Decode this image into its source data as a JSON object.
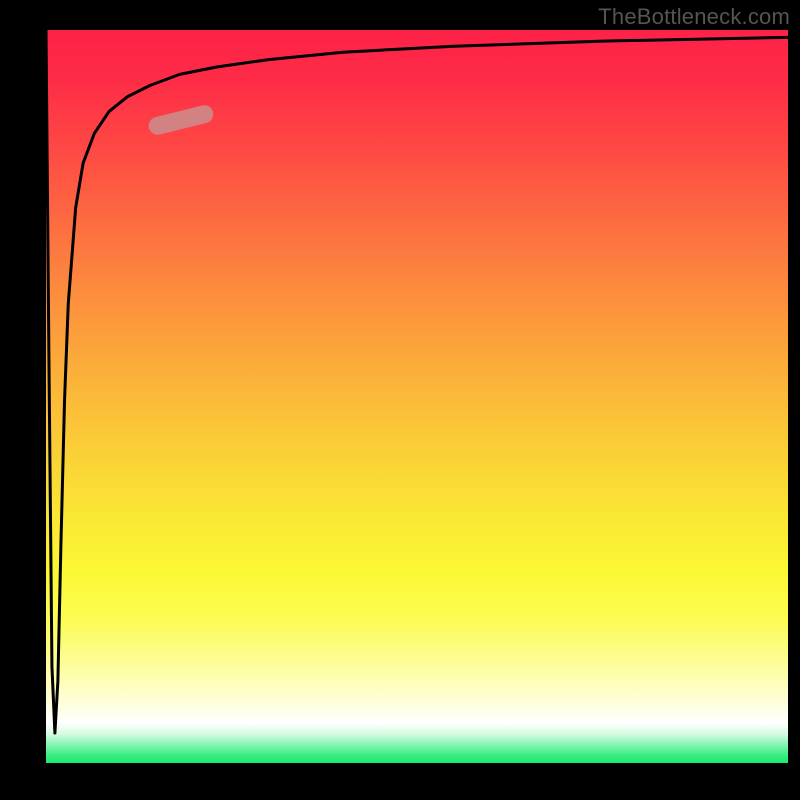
{
  "attribution": "TheBottleneck.com",
  "chart_data": {
    "type": "line",
    "title": "",
    "xlabel": "",
    "ylabel": "",
    "xlim": [
      0,
      100
    ],
    "ylim": [
      0,
      100
    ],
    "series": [
      {
        "name": "bottleneck-curve",
        "x": [
          0,
          0.4,
          0.8,
          1.2,
          1.6,
          2.0,
          2.5,
          3.0,
          4.0,
          5.0,
          6.5,
          8.5,
          11.0,
          14.0,
          18.0,
          23.0,
          30.0,
          40.0,
          55.0,
          75.0,
          100.0
        ],
        "values": [
          100,
          55,
          14,
          5,
          12,
          30,
          50,
          63,
          76,
          82,
          86,
          89,
          91,
          92.5,
          94,
          95,
          96,
          97,
          97.8,
          98.5,
          99.0
        ]
      }
    ],
    "marker": {
      "x": 18.2,
      "y": 87.8,
      "angle_deg": 14
    },
    "background_gradient": {
      "top": "#fe2247",
      "mid": "#fbe635",
      "bottom": "#19ea6e"
    }
  }
}
